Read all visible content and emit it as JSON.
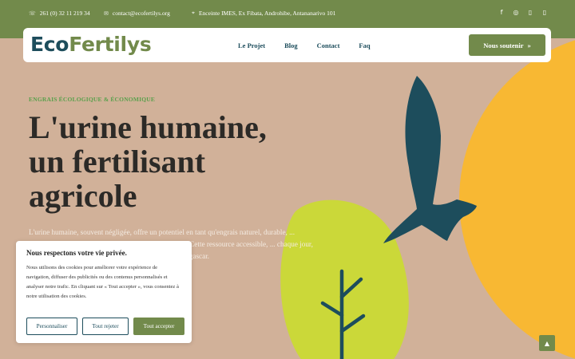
{
  "topbar": {
    "phone": "261 (0) 32 11 219 34",
    "email": "contact@ecofertilys.org",
    "address": "Enceinte IMES, Ex Fibata, Androhibe, Antananarivo 101",
    "social": [
      "facebook-icon",
      "instagram-icon",
      "linkedin-icon",
      "youtube-icon"
    ]
  },
  "nav": {
    "logo_part1": "Eco",
    "logo_part2": "Fertilys",
    "items": [
      "Le Projet",
      "Blog",
      "Contact",
      "Faq"
    ],
    "cta": "Nous soutenir",
    "cta_icon": "»"
  },
  "hero": {
    "kicker": "ENGRAIS ÉCOLOGIQUE & ÉCONOMIQUE",
    "title_line1": "L'urine humaine,",
    "title_line2": "un fertilisant",
    "title_line3": "agricole",
    "paragraph": "L'urine humaine, souvent négligée, offre un potentiel en tant qu'engrais naturel, durable, ... nutriments essentiels, l'urine se présente ... chimiques. Cette ressource accessible, ... chaque jour, peut démocratiser les ... depuis trop longtemps à Madagascar."
  },
  "cookie": {
    "title": "Nous respectons votre vie privée.",
    "text": "Nous utilisons des cookies pour améliorer votre expérience de navigation, diffuser des publicités ou des contenus personnalisés et analyser notre trafic. En cliquant sur « Tout accepter », vous consentez à notre utilisation des cookies.",
    "btn_customize": "Personnaliser",
    "btn_reject": "Tout rejeter",
    "btn_accept": "Tout accepter"
  },
  "colors": {
    "green": "#728a4b",
    "teal": "#1d4d5c",
    "sand": "#d1b199",
    "yellow": "#f8b833",
    "lime": "#cbd839"
  }
}
